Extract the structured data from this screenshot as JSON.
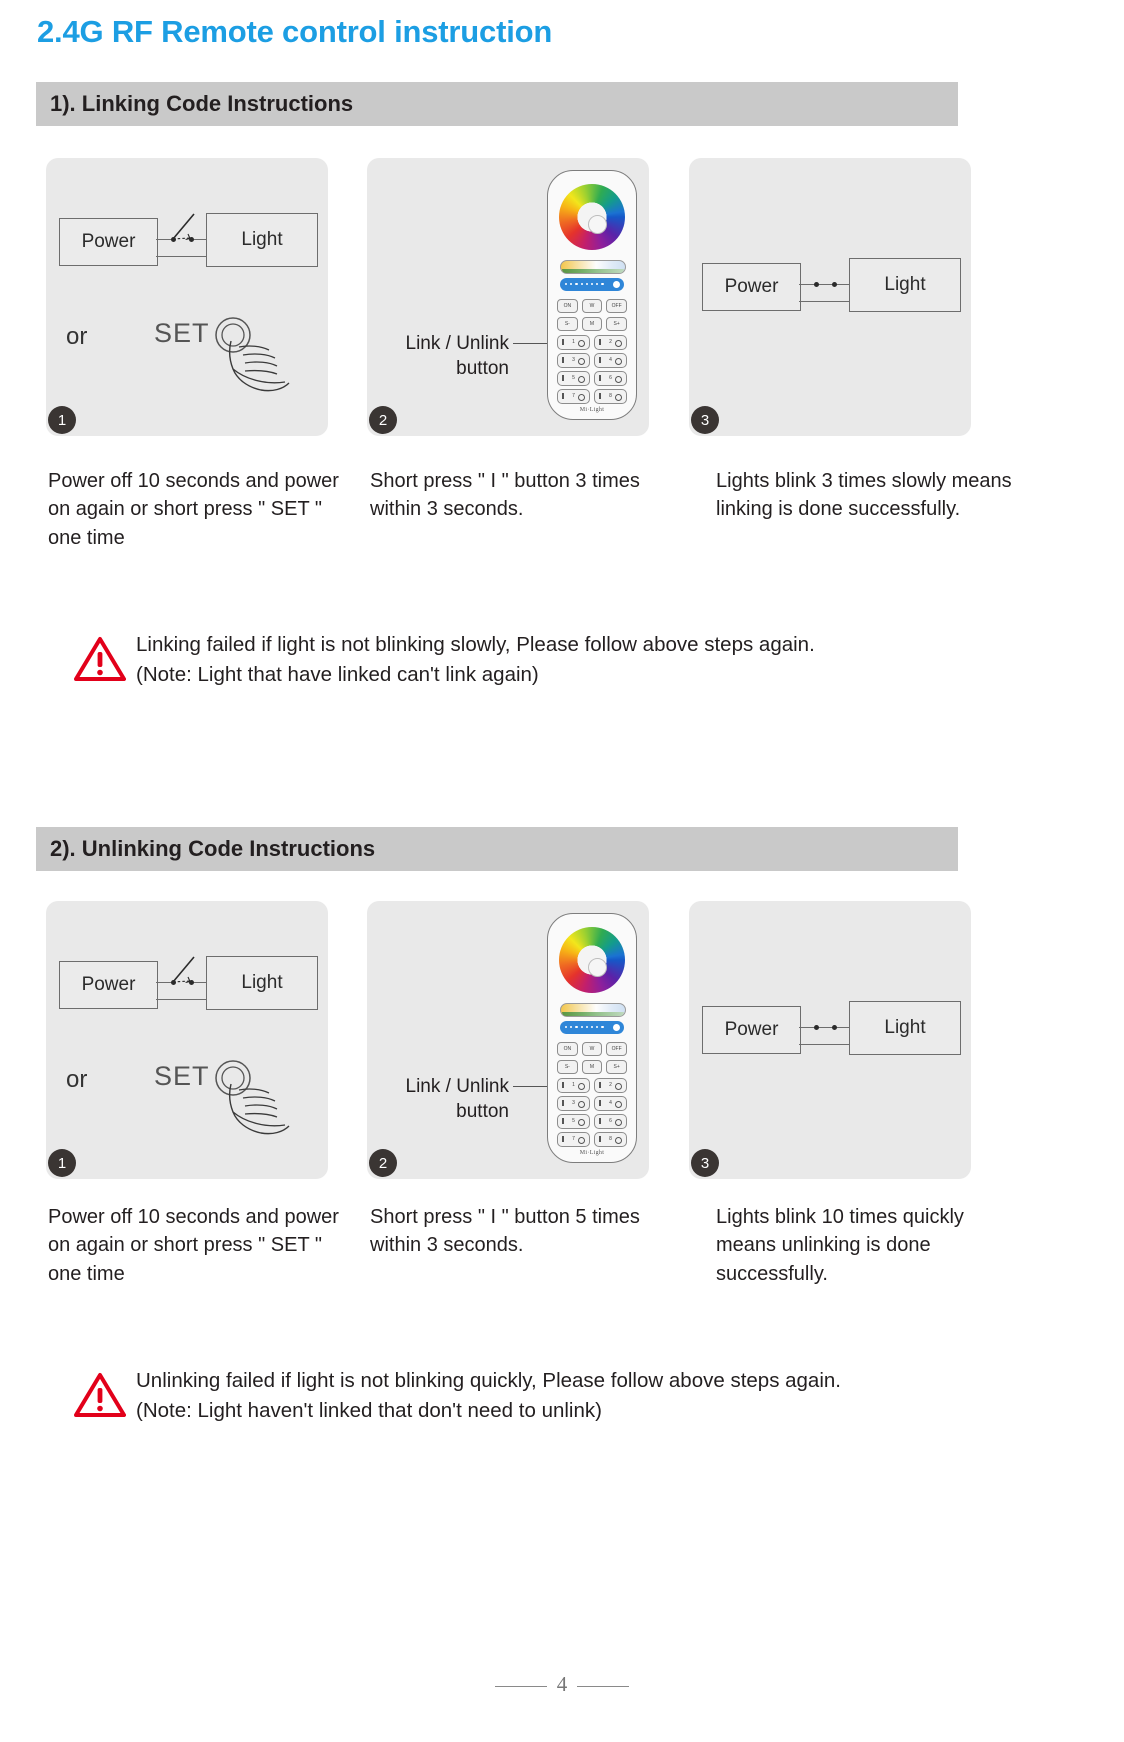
{
  "document": {
    "title": "2.4G RF Remote control instruction",
    "title_color": "#1c9ee3",
    "page_number": "4"
  },
  "sections": [
    {
      "id": "linking",
      "heading": "1). Linking Code Instructions",
      "steps": [
        {
          "badge": "1",
          "caption": "Power off 10 seconds and power on again or short press \" SET \" one time",
          "diagram": {
            "type": "circuit-switch-open",
            "power_label": "Power",
            "light_label": "Light",
            "or_label": "or",
            "set_label": "SET"
          }
        },
        {
          "badge": "2",
          "caption": "Short press \"  I  \" button 3 times within 3 seconds.",
          "diagram": {
            "type": "remote",
            "leader_label_line1": "Link / Unlink",
            "leader_label_line2": "button"
          }
        },
        {
          "badge": "3",
          "caption": "Lights blink 3 times slowly means linking is done successfully.",
          "diagram": {
            "type": "circuit-closed",
            "power_label": "Power",
            "light_label": "Light"
          }
        }
      ],
      "note": {
        "line1": "Linking failed if light is not blinking slowly, Please follow above steps again.",
        "line2": "(Note: Light that have linked can't link again)",
        "icon": "warning-triangle-icon",
        "icon_color": "#e2001a"
      }
    },
    {
      "id": "unlinking",
      "heading": "2). Unlinking Code Instructions",
      "steps": [
        {
          "badge": "1",
          "caption": "Power off 10 seconds and power on again or short press \" SET \" one time",
          "diagram": {
            "type": "circuit-switch-open",
            "power_label": "Power",
            "light_label": "Light",
            "or_label": "or",
            "set_label": "SET"
          }
        },
        {
          "badge": "2",
          "caption": "Short press \"  I  \" button 5 times within 3 seconds.",
          "diagram": {
            "type": "remote",
            "leader_label_line1": "Link / Unlink",
            "leader_label_line2": "button"
          }
        },
        {
          "badge": "3",
          "caption": "Lights blink 10 times quickly means unlinking is done successfully.",
          "diagram": {
            "type": "circuit-closed",
            "power_label": "Power",
            "light_label": "Light"
          }
        }
      ],
      "note": {
        "line1": "Unlinking failed if light is not blinking quickly, Please follow above steps again.",
        "line2": "(Note: Light haven't linked that don't need to unlink)",
        "icon": "warning-triangle-icon",
        "icon_color": "#e2001a"
      }
    }
  ],
  "remote": {
    "brand": "Mi·Light",
    "top_row_buttons": [
      "ON",
      "W",
      "OFF"
    ],
    "second_row_buttons": [
      "S-",
      "M",
      "S+"
    ],
    "zone_buttons": [
      "1",
      "2",
      "3",
      "4",
      "5",
      "6",
      "7",
      "8"
    ],
    "wheel": "color-wheel",
    "cct_bar": "color-temperature-slider",
    "brightness_bar": "brightness-slider"
  }
}
